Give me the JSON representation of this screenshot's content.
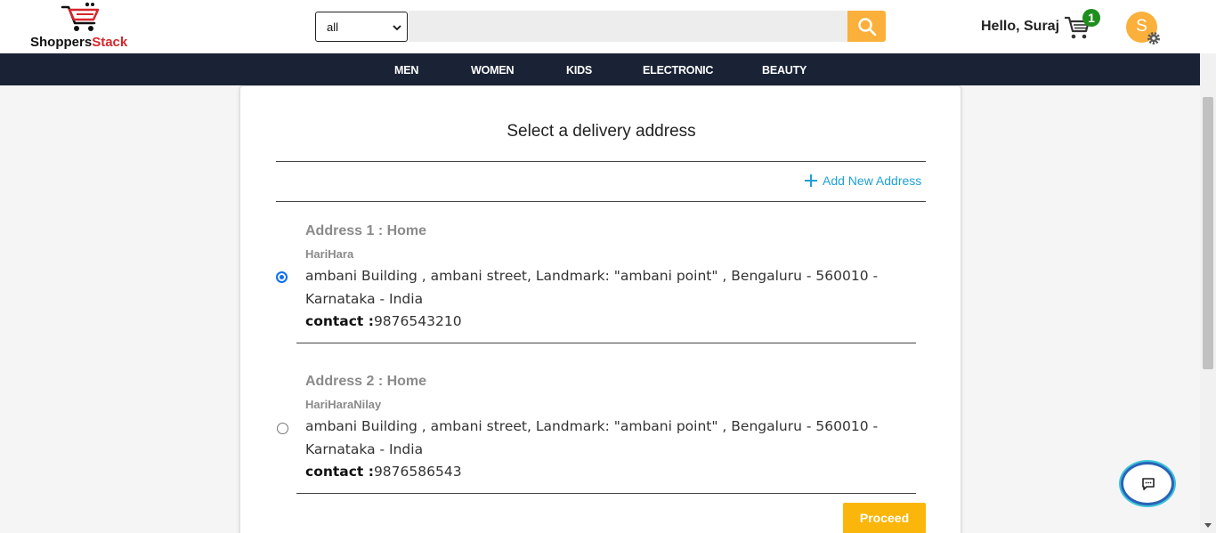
{
  "header": {
    "logo": {
      "text_main": "Shoppers",
      "text_accent": "Stack"
    },
    "search": {
      "category_selected": "all",
      "placeholder": "",
      "button_icon": "search-icon"
    },
    "greeting": "Hello, Suraj",
    "cart": {
      "icon": "cart-icon",
      "count": "1"
    },
    "avatar": {
      "initial": "S",
      "icon": "gear-icon"
    }
  },
  "nav": {
    "items": [
      "MEN",
      "WOMEN",
      "KIDS",
      "ELECTRONIC",
      "BEAUTY"
    ]
  },
  "delivery": {
    "title": "Select a delivery address",
    "add_new_label": "Add New Address",
    "addresses": [
      {
        "heading": "Address 1 :   Home",
        "name": "HariHara",
        "line": "ambani Building , ambani street, Landmark: \"ambani point\" , Bengaluru - 560010 - Karnataka - India",
        "contact_label": "contact :",
        "contact_value": "9876543210",
        "selected": true
      },
      {
        "heading": "Address 2 :   Home",
        "name": "HariHaraNilay",
        "line": "ambani Building , ambani street, Landmark: \"ambani point\" , Bengaluru - 560010 - Karnataka - India",
        "contact_label": "contact :",
        "contact_value": "9876586543",
        "selected": false
      }
    ],
    "proceed_label": "Proceed"
  },
  "colors": {
    "nav_bg": "#1a2336",
    "accent": "#fbb03b",
    "link": "#1ea1d6",
    "badge": "#1e8e1e",
    "radio": "#0b6ff2"
  }
}
